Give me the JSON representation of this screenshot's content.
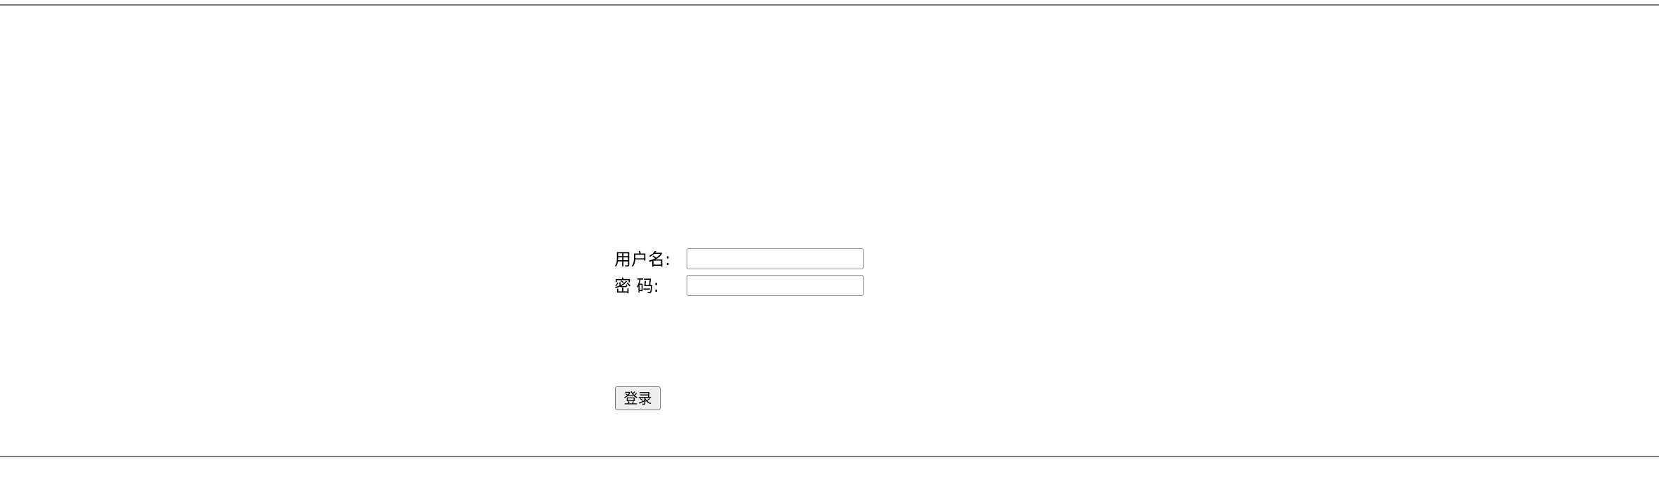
{
  "form": {
    "username_label": "用户名:",
    "username_value": "",
    "password_label": "密 码:",
    "password_value": "",
    "login_label": "登录"
  }
}
